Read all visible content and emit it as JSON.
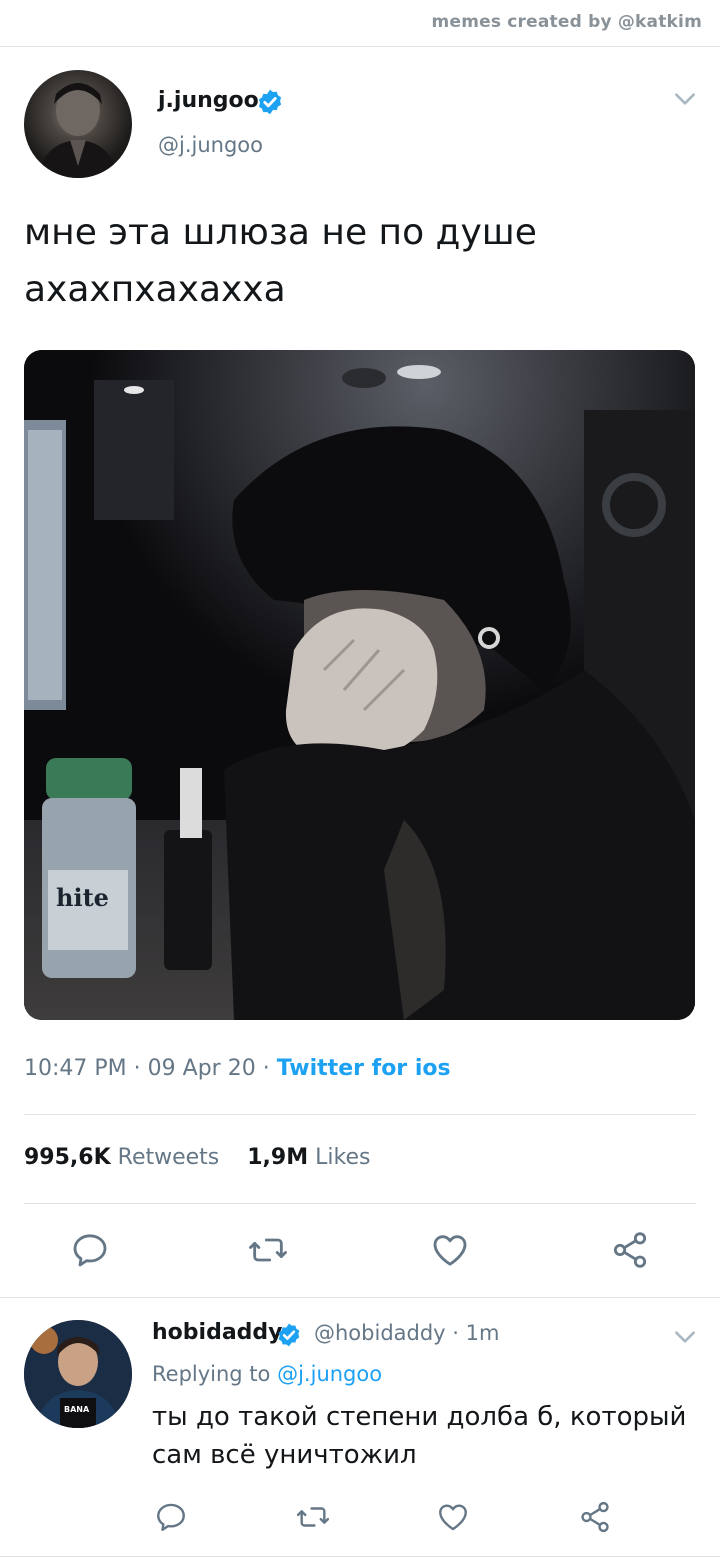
{
  "credit": "memes created by @katkim",
  "tweet": {
    "author": {
      "name": "j.jungoo",
      "handle": "@j.jungoo",
      "verified": true
    },
    "text_line1": "мне эта шлюза не по душе",
    "text_line2": "ахахпхахахха",
    "time": "10:47 PM",
    "date": "09 Apr 20",
    "source": "Twitter for ios",
    "retweets_count": "995,6K",
    "retweets_label": "Retweets",
    "likes_count": "1,9M",
    "likes_label": "Likes",
    "media_bottle_text": "hite"
  },
  "reply": {
    "author": {
      "name": "hobidaddy",
      "handle": "@hobidaddy",
      "verified": true
    },
    "time": "1m",
    "replying_label": "Replying to",
    "replying_to": "@j.jungoo",
    "text_line1": "ты до такой степени долба б, который",
    "text_line2": "сам всё уничтожил"
  },
  "colors": {
    "accent": "#1da1f2",
    "secondary_text": "#657786",
    "divider": "#dfe3e6"
  },
  "icons": [
    "verified-badge-icon",
    "chevron-down-icon",
    "reply-icon",
    "retweet-icon",
    "like-icon",
    "share-icon"
  ]
}
